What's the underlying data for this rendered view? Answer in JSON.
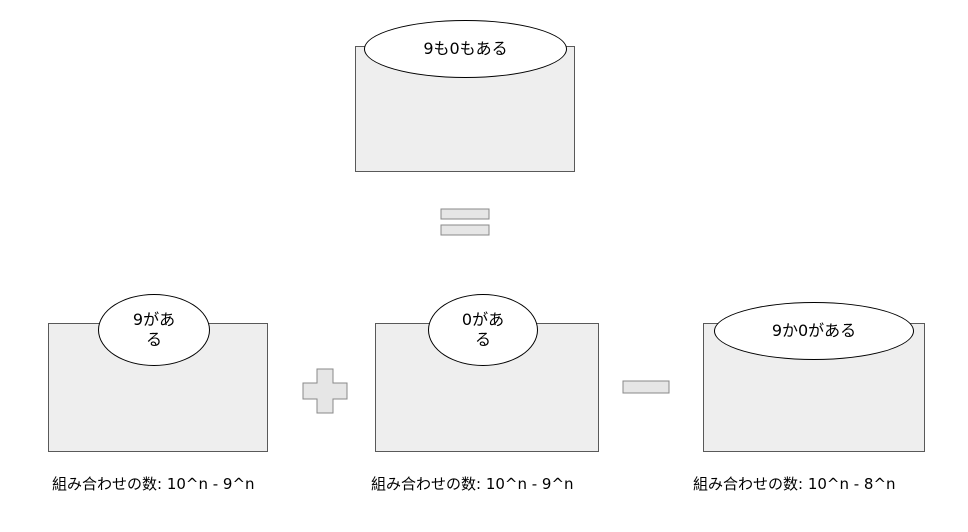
{
  "top": {
    "label": "9も0もある"
  },
  "operators": {
    "equals": "=",
    "plus": "+",
    "minus": "−"
  },
  "sets": [
    {
      "label": "9がある",
      "caption": "組み合わせの数: 10^n - 9^n"
    },
    {
      "label": "0がある",
      "caption": "組み合わせの数: 10^n - 9^n"
    },
    {
      "label": "9か0がある",
      "caption": "組み合わせの数: 10^n - 8^n"
    }
  ],
  "colors": {
    "box_fill": "#eeeeee",
    "box_border": "#595959",
    "operator_fill": "#e6e6e6",
    "operator_stroke": "#888888"
  }
}
